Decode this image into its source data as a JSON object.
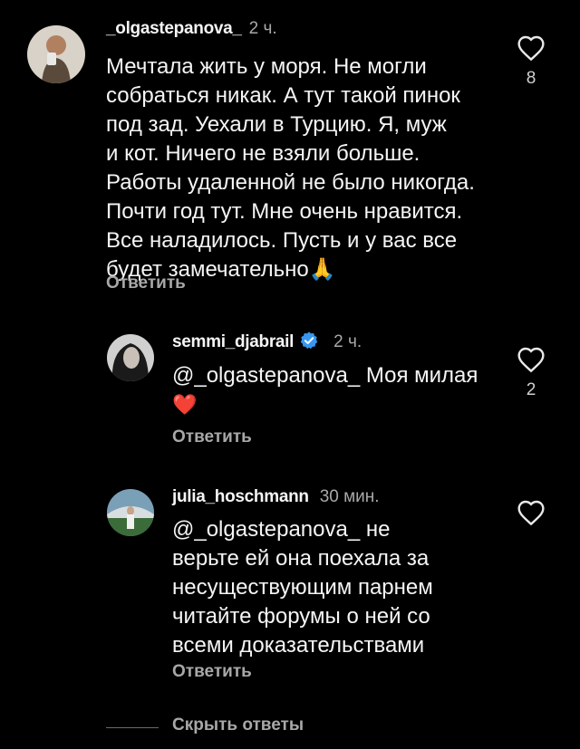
{
  "comments": [
    {
      "username": "_olgastepanova_",
      "time": "2 ч.",
      "lines": [
        "Мечтала жить у моря. Не могли",
        "собраться никак. А тут такой пинок",
        "под зад. Уехали в Турцию. Я, муж",
        "и кот. Ничего не взяли больше.",
        "Работы удаленной не было никогда.",
        "Почти год тут. Мне очень нравится.",
        "Все наладилось. Пусть и у вас все",
        "будет замечательно🙏"
      ],
      "reply_label": "Ответить",
      "like_count": "8"
    },
    {
      "username": "semmi_djabrail",
      "verified": true,
      "time": "2 ч.",
      "lines": [
        "@_olgastepanova_ Моя милая",
        "❤️"
      ],
      "reply_label": "Ответить",
      "like_count": "2"
    },
    {
      "username": "julia_hoschmann",
      "time": "30 мин.",
      "lines": [
        "@_olgastepanova_ не",
        "верьте ей она поехала за",
        "несуществующим парнем",
        "читайте форумы о ней со",
        "всеми доказательствами"
      ],
      "reply_label": "Ответить",
      "like_count": ""
    }
  ],
  "hide_replies_label": "Скрыть ответы",
  "colors": {
    "background": "#000000",
    "text": "#f5f5f5",
    "secondary": "#a8a8a8",
    "verified": "#3897f0"
  }
}
